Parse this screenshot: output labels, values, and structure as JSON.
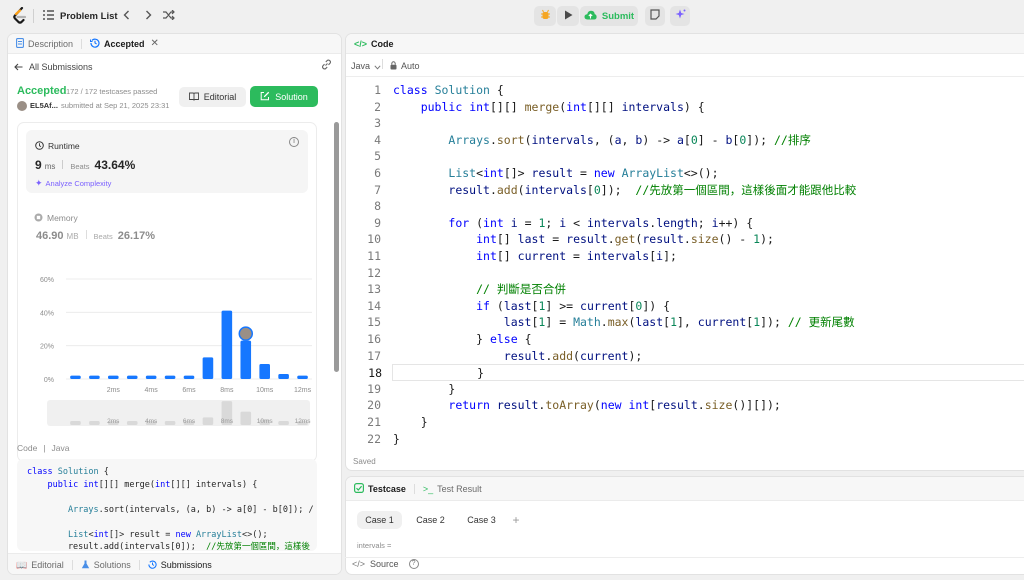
{
  "topbar": {
    "title": "Problem List",
    "submit": "Submit"
  },
  "left": {
    "tab_description": "Description",
    "tab_accepted": "Accepted",
    "back": "All Submissions",
    "status": "Accepted",
    "passed": "172 / 172 testcases passed",
    "user": "EL5Af...",
    "submitted": "submitted at Sep 21, 2025 23:31",
    "editorial_btn": "Editorial",
    "solution_btn": "Solution",
    "runtime_label": "Runtime",
    "runtime_val": "9",
    "runtime_unit": "ms",
    "beats_label": "Beats",
    "runtime_beats": "43.64%",
    "analyze": "Analyze Complexity",
    "memory_label": "Memory",
    "memory_val": "46.90",
    "memory_unit": "MB",
    "memory_beats": "26.17%",
    "code_label": "Code",
    "code_lang": "Java",
    "preview": [
      "class Solution {",
      "    public int[][] merge(int[][] intervals) {",
      "",
      "        Arrays.sort(intervals, (a, b) -> a[0] - b[0]); /",
      "",
      "        List<int[]> result = new ArrayList<>();",
      "        result.add(intervals[0]);  //先放第一個區間，這樣後",
      "    }"
    ],
    "bottom_tabs": [
      "Editorial",
      "Solutions",
      "Submissions"
    ]
  },
  "chart_data": {
    "type": "bar",
    "x": [
      "0ms",
      "1ms",
      "2ms",
      "3ms",
      "4ms",
      "5ms",
      "6ms",
      "7ms",
      "8ms",
      "9ms",
      "10ms",
      "11ms",
      "12ms"
    ],
    "values": [
      2,
      2,
      2,
      2,
      2,
      2,
      2,
      13,
      41,
      23,
      9,
      3,
      2
    ],
    "yticks": [
      "0%",
      "20%",
      "40%",
      "60%"
    ],
    "xticks": [
      "2ms",
      "4ms",
      "6ms",
      "8ms",
      "10ms",
      "12ms"
    ],
    "ylim": [
      0,
      60
    ],
    "highlight_index": 9,
    "color": "#1677ff"
  },
  "editor": {
    "header": "Code",
    "lang": "Java",
    "mode": "Auto",
    "saved": "Saved",
    "line_numbers": [
      "1",
      "2",
      "3",
      "4",
      "5",
      "6",
      "7",
      "8",
      "9",
      "10",
      "11",
      "12",
      "13",
      "14",
      "15",
      "16",
      "17",
      "18",
      "19",
      "20",
      "21",
      "22"
    ],
    "lines": [
      "class Solution {",
      "    public int[][] merge(int[][] intervals) {",
      "",
      "        Arrays.sort(intervals, (a, b) -> a[0] - b[0]); //排序",
      "",
      "        List<int[]> result = new ArrayList<>();",
      "        result.add(intervals[0]);  //先放第一個區間，這樣後面才能跟他比較",
      "",
      "        for (int i = 1; i < intervals.length; i++) {",
      "            int[] last = result.get(result.size() - 1);",
      "            int[] current = intervals[i];",
      "",
      "            // 判斷是否合併",
      "            if (last[1] >= current[0]) {",
      "                last[1] = Math.max(last[1], current[1]); // 更新尾數",
      "            } else {",
      "                result.add(current);",
      "            }",
      "        }",
      "        return result.toArray(new int[result.size()][]);",
      "    }",
      "}"
    ]
  },
  "testcase": {
    "tab": "Testcase",
    "result_tab": "Test Result",
    "cases": [
      "Case 1",
      "Case 2",
      "Case 3"
    ],
    "plus": "+",
    "var": "intervals =",
    "source": "Source"
  }
}
